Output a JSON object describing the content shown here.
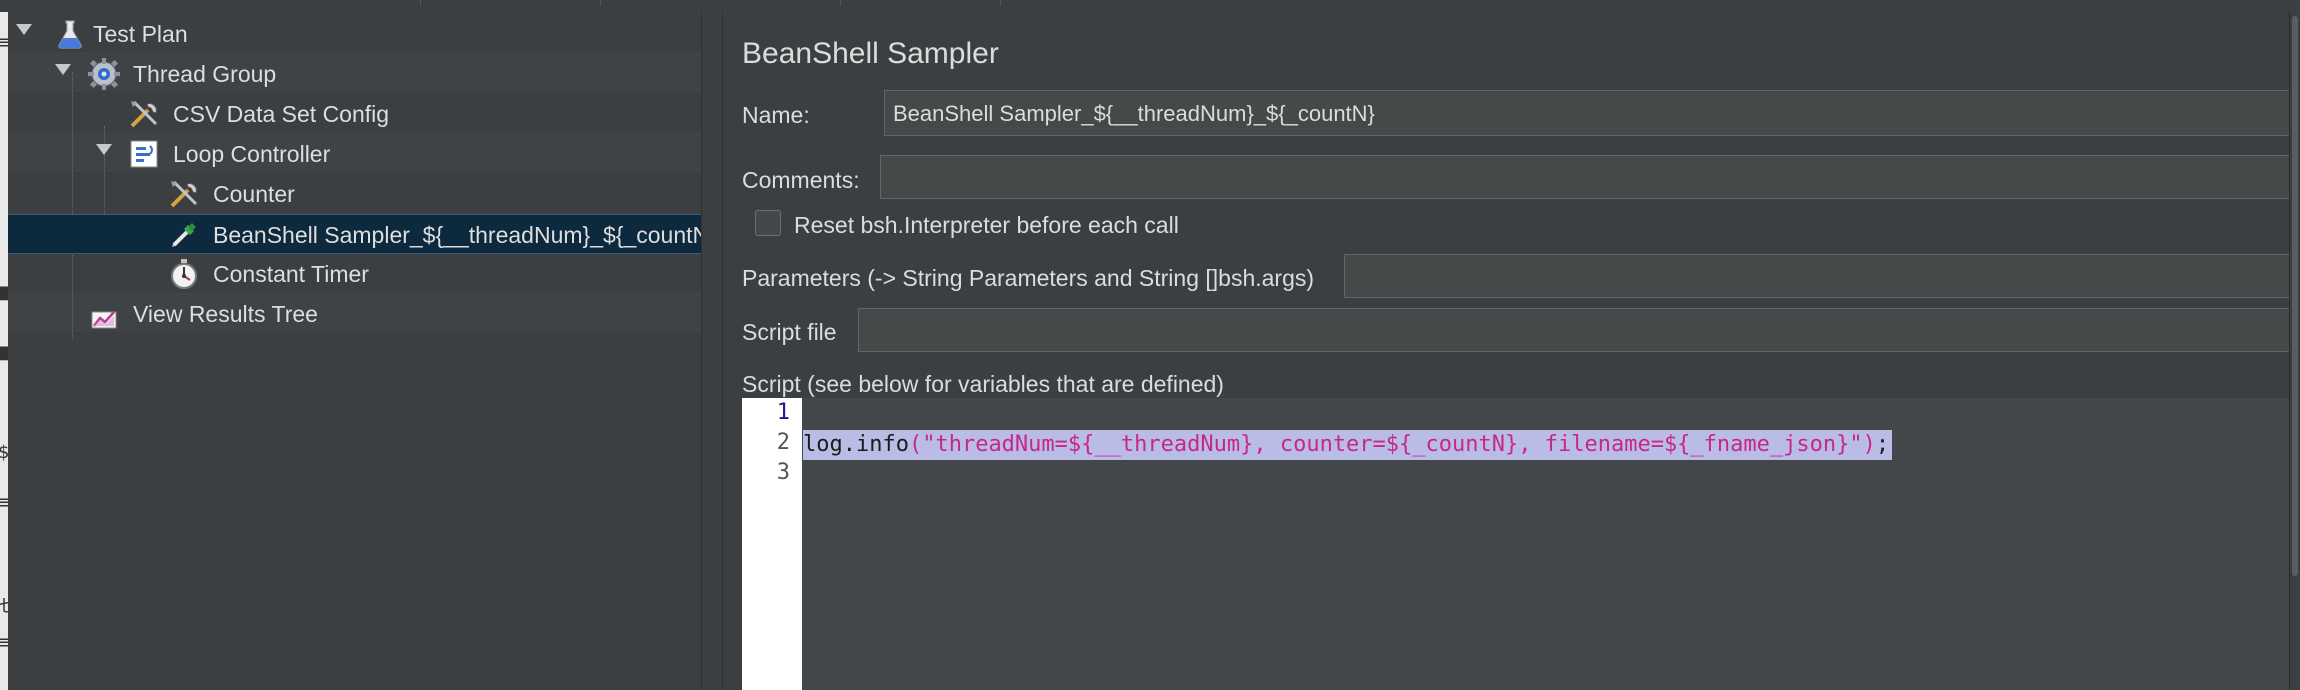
{
  "tree": {
    "items": [
      {
        "label": "Test Plan",
        "icon": "flask-icon"
      },
      {
        "label": "Thread Group",
        "icon": "gear-icon"
      },
      {
        "label": "CSV Data Set Config",
        "icon": "tools-icon"
      },
      {
        "label": "Loop Controller",
        "icon": "loop-controller-icon"
      },
      {
        "label": "Counter",
        "icon": "tools-icon"
      },
      {
        "label": "BeanShell Sampler_${__threadNum}_${_countN}",
        "icon": "pipette-icon"
      },
      {
        "label": "Constant Timer",
        "icon": "stopwatch-icon"
      },
      {
        "label": "View Results Tree",
        "icon": "graph-icon"
      }
    ]
  },
  "panel": {
    "title": "BeanShell Sampler",
    "name_label": "Name:",
    "name_value": "BeanShell Sampler_${__threadNum}_${_countN}",
    "comments_label": "Comments:",
    "comments_value": "",
    "reset_label": "Reset bsh.Interpreter before each call",
    "reset_checked": false,
    "parameters_label": "Parameters (-> String Parameters and String []bsh.args)",
    "parameters_value": "",
    "script_file_label": "Script file",
    "script_file_value": "",
    "script_label": "Script (see below for variables that are defined)",
    "script": {
      "line_numbers": [
        "1",
        "2",
        "3"
      ],
      "code_fn": "log.info",
      "code_str": "(\"threadNum=${__threadNum}, counter=${_countN}, filename=${_fname_json}\")",
      "code_end": ";"
    }
  },
  "colors": {
    "background": "#3c3f41",
    "selection": "#0d293e",
    "string": "#c8268f",
    "highlight": "#b9bde6"
  }
}
